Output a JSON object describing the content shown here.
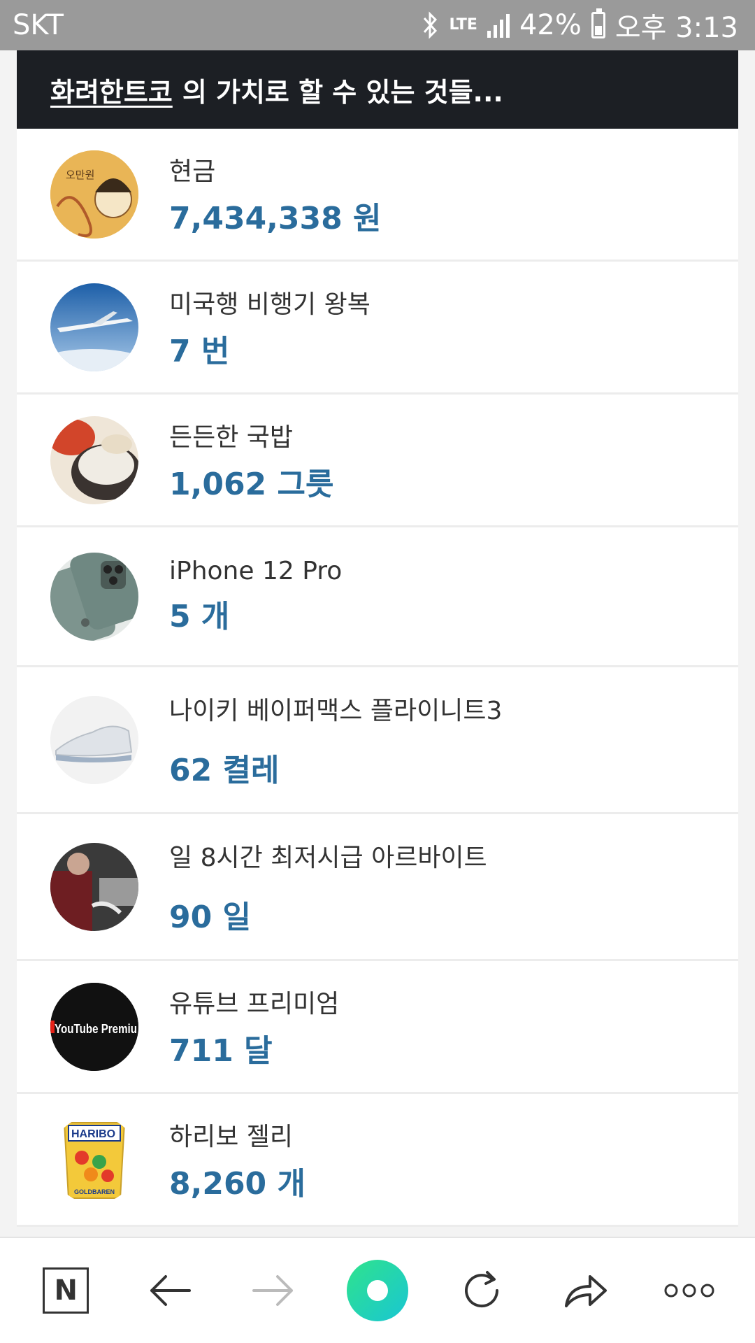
{
  "status_bar": {
    "carrier": "SKT",
    "network": "LTE",
    "battery": "42%",
    "time": "오후 3:13"
  },
  "header": {
    "brand": "화려한트코",
    "suffix": "의 가치로 할 수 있는 것들..."
  },
  "items": [
    {
      "label": "현금",
      "value": "7,434,338 원",
      "icon": "cash-bill-thumbnail",
      "thumb_text": "오만원"
    },
    {
      "label": "미국행 비행기 왕복",
      "value": "7 번",
      "icon": "airplane-thumbnail"
    },
    {
      "label": "든든한 국밥",
      "value": "1,062 그릇",
      "icon": "gukbap-thumbnail"
    },
    {
      "label": "iPhone 12 Pro",
      "value": "5 개",
      "icon": "iphone-thumbnail"
    },
    {
      "label": "나이키 베이퍼맥스 플라이니트3",
      "value": "62 켤레",
      "icon": "sneaker-thumbnail"
    },
    {
      "label": "일 8시간 최저시급 아르바이트",
      "value": "90 일",
      "icon": "part-time-job-thumbnail"
    },
    {
      "label": "유튜브 프리미엄",
      "value": "711 달",
      "icon": "youtube-premium-thumbnail",
      "thumb_text": "YouTube Premiu"
    },
    {
      "label": "하리보 젤리",
      "value": "8,260 개",
      "icon": "haribo-thumbnail",
      "thumb_text": "HARIBO",
      "thumb_text2": "GOLDBAREN"
    }
  ],
  "bottom_nav": {
    "home_label": "N"
  },
  "colors": {
    "value_blue": "#2a6c9c",
    "header_bg": "#1c1f24",
    "status_bg": "#9a9a9a"
  }
}
